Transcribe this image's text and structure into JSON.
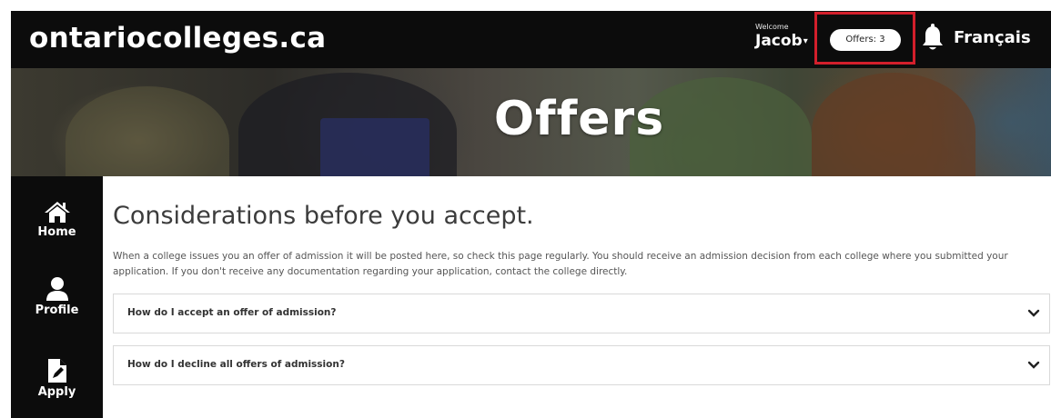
{
  "header": {
    "logo": "ontariocolleges.ca",
    "welcome_label": "Welcome",
    "user_name": "Jacob",
    "offers_button": "Offers: 3",
    "language_link": "Français"
  },
  "hero": {
    "title": "Offers"
  },
  "sidebar": {
    "items": [
      {
        "label": "Home",
        "icon": "home-icon"
      },
      {
        "label": "Profile",
        "icon": "profile-icon"
      },
      {
        "label": "Apply",
        "icon": "apply-icon"
      }
    ]
  },
  "main": {
    "heading": "Considerations before you accept.",
    "intro": "When a college issues you an offer of admission it will be posted here, so check this page regularly. You should receive an admission decision from each college where you submitted your application. If you don't receive any documentation regarding your application, contact the college directly.",
    "accordions": [
      {
        "title": "How do I accept an offer of admission?"
      },
      {
        "title": "How do I decline all offers of admission?"
      }
    ]
  },
  "colors": {
    "header_bg": "#0c0c0c",
    "highlight": "#d31f2b"
  }
}
